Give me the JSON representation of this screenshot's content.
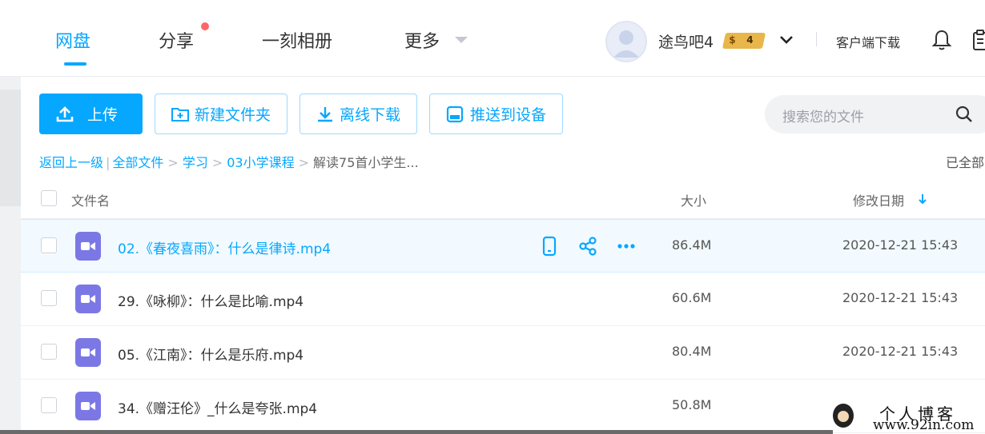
{
  "nav": {
    "tabs": [
      {
        "label": "网盘",
        "active": true
      },
      {
        "label": "分享",
        "active": false,
        "has_dot": true
      },
      {
        "label": "一刻相册",
        "active": false
      },
      {
        "label": "更多",
        "active": false
      }
    ],
    "username": "途鸟吧4",
    "vip_level": "4",
    "vip_coin": "$",
    "client_download": "客户端下载",
    "icons": [
      "avatar-icon",
      "chevron-down-icon",
      "bell-icon",
      "clipboard-icon"
    ]
  },
  "toolbar": {
    "upload": "上传",
    "new_folder": "新建文件夹",
    "offline_download": "离线下载",
    "push_device": "推送到设备"
  },
  "search": {
    "placeholder": "搜索您的文件"
  },
  "breadcrumb": {
    "back": "返回上一级",
    "items": [
      "全部文件",
      "学习",
      "03小学课程"
    ],
    "current": "解读75首小学生..."
  },
  "loaded_status": "已全部",
  "table": {
    "headers": {
      "name": "文件名",
      "size": "大小",
      "date": "修改日期"
    },
    "rows": [
      {
        "name": "02.《春夜喜雨》：什么是律诗.mp4",
        "size": "86.4M",
        "date": "2020-12-21 15:43",
        "hover": true
      },
      {
        "name": "29.《咏柳》：什么是比喻.mp4",
        "size": "60.6M",
        "date": "2020-12-21 15:43"
      },
      {
        "name": "05.《江南》：什么是乐府.mp4",
        "size": "80.4M",
        "date": "2020-12-21 15:43"
      },
      {
        "name": "34.《赠汪伦》_什么是夸张.mp4",
        "size": "50.8M",
        "date": ""
      }
    ]
  },
  "watermark": {
    "title": "个人博客",
    "url": "www.92in.com"
  },
  "colors": {
    "accent": "#06a7ff",
    "file_icon": "#7b78e6",
    "dot": "#ff6666",
    "vip": "#e8b64a"
  }
}
